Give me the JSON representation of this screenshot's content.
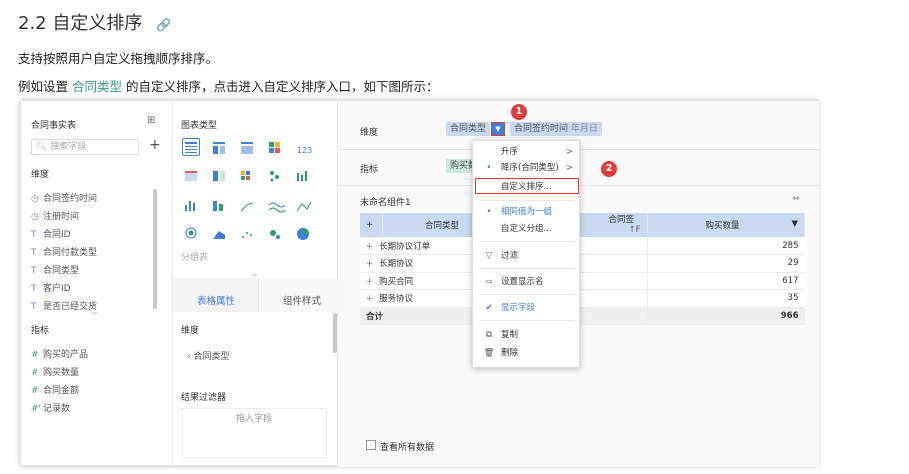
{
  "doc": {
    "title": "2.2 自定义排序",
    "link_icon": "link-icon",
    "para1": "支持按照用户自定义拖拽顺序排序。",
    "para2_pre": "例如设置 ",
    "para2_hl": "合同类型",
    "para2_post": " 的自定义排序，点击进入自定义排序入口，如下图所示："
  },
  "data_panel": {
    "title": "合同事实表",
    "search_placeholder": "搜索字段",
    "dim_title": "维度",
    "dims": [
      "合同签约时间",
      "注册时间",
      "合同ID",
      "合同付款类型",
      "合同类型",
      "客户ID",
      "是否已经交货"
    ],
    "dim_icons": [
      "◷",
      "◷",
      "T",
      "T",
      "T",
      "T",
      "T"
    ],
    "ind_title": "指标",
    "inds": [
      "购买的产品",
      "购买数量",
      "合同金额",
      "记录数"
    ],
    "ind_icons": [
      "#",
      "#",
      "#",
      "#'"
    ]
  },
  "chart_panel": {
    "title": "图表类型",
    "group_label": "分组表",
    "tab_active": "表格属性",
    "tab_other": "组件样式",
    "dim_label": "维度",
    "dim_item": "合同类型",
    "filter_title": "结果过滤器",
    "filter_placeholder": "拖入字段"
  },
  "main": {
    "dim_label": "维度",
    "dim_pill1": "合同类型",
    "dim_pill2": "合同签约时间",
    "dim_pill2_sub": "年月日",
    "ind_label": "指标",
    "ind_pill": "购买数量",
    "component_title": "未命名组件1",
    "table": {
      "headers": [
        "+",
        "合同类型",
        "合同签约时间",
        "购买数量"
      ],
      "header3_sort_icon": "↑F",
      "header4_sort_icon": "▼",
      "rows": [
        {
          "name": "长期协议订单",
          "value": "285"
        },
        {
          "name": "长期协议",
          "value": "29"
        },
        {
          "name": "购买合同",
          "value": "617"
        },
        {
          "name": "服务协议",
          "value": "35"
        }
      ],
      "total_label": "合计",
      "total_value": "966"
    },
    "show_all": "查看所有数据"
  },
  "menu": {
    "items": [
      {
        "label": "升序",
        "icon": "",
        "chevron": ">"
      },
      {
        "label": "降序(合同类型)",
        "icon": "•",
        "chevron": ">"
      },
      {
        "label": "自定义排序...",
        "icon": "",
        "chevron": ""
      },
      {
        "label": "相同值为一组",
        "icon": "•",
        "chevron": ""
      },
      {
        "label": "自定义分组...",
        "icon": "",
        "chevron": ""
      },
      {
        "label": "过滤",
        "icon": "▽",
        "chevron": ""
      },
      {
        "label": "设置显示名",
        "icon": "⇨",
        "chevron": ""
      },
      {
        "label": "显示字段",
        "icon": "✔",
        "chevron": ""
      },
      {
        "label": "复制",
        "icon": "⧉",
        "chevron": ""
      },
      {
        "label": "删除",
        "icon": "🗑",
        "chevron": ""
      }
    ]
  },
  "badges": [
    "1",
    "2"
  ],
  "colors": {
    "accent_blue": "#3f7fd8",
    "dim_pill": "#c9d9f2",
    "ind_pill": "#cbe8df",
    "highlight_red": "#e03c3c",
    "link_green": "#3d9a88"
  }
}
